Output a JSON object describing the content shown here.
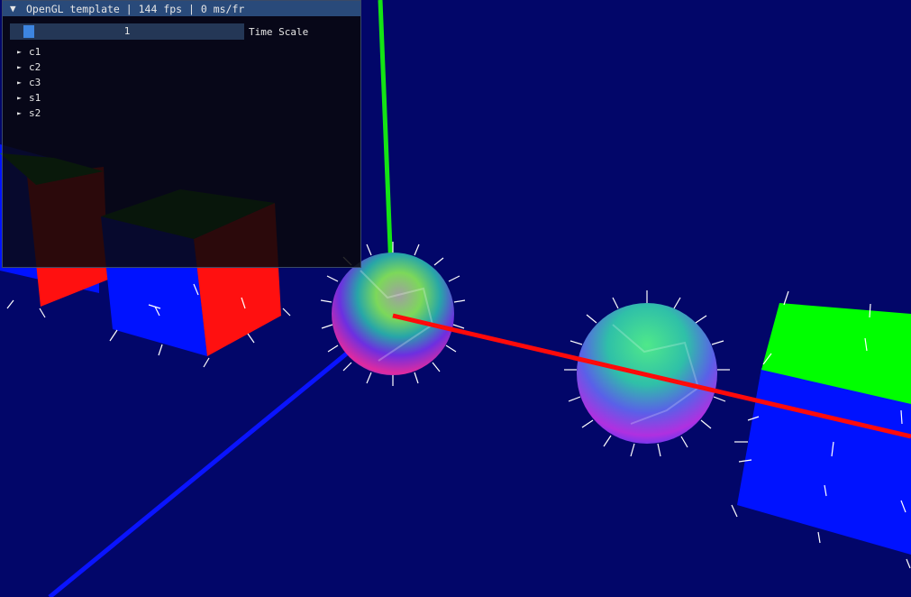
{
  "window": {
    "collapse_glyph": "▼",
    "title": "OpenGL template | 144 fps | 0 ms/fr"
  },
  "controls": {
    "time_scale": {
      "label": "Time Scale",
      "value": "1",
      "fraction": 0.06
    }
  },
  "tree": {
    "items": [
      {
        "arrow": "►",
        "label": "c1"
      },
      {
        "arrow": "►",
        "label": "c2"
      },
      {
        "arrow": "►",
        "label": "c3"
      },
      {
        "arrow": "►",
        "label": "s1"
      },
      {
        "arrow": "►",
        "label": "s2"
      }
    ]
  },
  "scene": {
    "background": "#020669",
    "axis_colors": {
      "x": "#ff0000",
      "y": "#00ff00",
      "z": "#0000ff"
    },
    "normal_color": "#ffffff"
  }
}
